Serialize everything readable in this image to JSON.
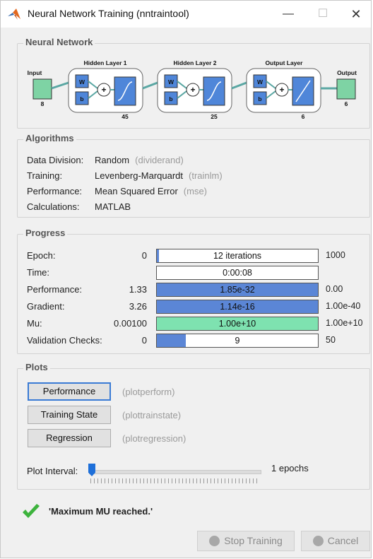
{
  "window": {
    "title": "Neural Network Training (nntraintool)",
    "controls": {
      "minimize": "—",
      "maximize": "☐",
      "close": "✕"
    }
  },
  "network": {
    "section_label": "Neural Network",
    "input": {
      "label": "Input",
      "size": "8"
    },
    "layers": [
      {
        "label": "Hidden Layer 1",
        "size": "45"
      },
      {
        "label": "Hidden Layer 2",
        "size": "25"
      },
      {
        "label": "Output Layer",
        "size": "6"
      }
    ],
    "output": {
      "label": "Output",
      "size": "6"
    },
    "weight_symbol": "W",
    "bias_symbol": "b",
    "colors": {
      "io_box": "#7ed3a4",
      "weight_box": "#4f86d9",
      "transfer_box": "#4f86d9",
      "connector": "#5aa7a3"
    }
  },
  "algorithms": {
    "section_label": "Algorithms",
    "rows": [
      {
        "label": "Data Division:",
        "value": "Random",
        "fn": "(dividerand)"
      },
      {
        "label": "Training:",
        "value": "Levenberg-Marquardt",
        "fn": "(trainlm)"
      },
      {
        "label": "Performance:",
        "value": "Mean Squared Error",
        "fn": "(mse)"
      },
      {
        "label": "Calculations:",
        "value": "MATLAB",
        "fn": ""
      }
    ]
  },
  "progress": {
    "section_label": "Progress",
    "rows": [
      {
        "label": "Epoch:",
        "start": "0",
        "text": "12 iterations",
        "end": "1000",
        "fill": 0.012,
        "color": "#5b86d6"
      },
      {
        "label": "Time:",
        "start": "",
        "text": "0:00:08",
        "end": "",
        "fill": 0,
        "color": "#5b86d6"
      },
      {
        "label": "Performance:",
        "start": "1.33",
        "text": "1.85e-32",
        "end": "0.00",
        "fill": 1,
        "color": "#5b86d6"
      },
      {
        "label": "Gradient:",
        "start": "3.26",
        "text": "1.14e-16",
        "end": "1.00e-40",
        "fill": 1,
        "color": "#5b86d6"
      },
      {
        "label": "Mu:",
        "start": "0.00100",
        "text": "1.00e+10",
        "end": "1.00e+10",
        "fill": 1,
        "color": "#7ee2b0"
      },
      {
        "label": "Validation Checks:",
        "start": "0",
        "text": "9",
        "end": "50",
        "fill": 0.18,
        "color": "#5b86d6"
      }
    ]
  },
  "plots": {
    "section_label": "Plots",
    "buttons": [
      {
        "label": "Performance",
        "fn": "(plotperform)"
      },
      {
        "label": "Training State",
        "fn": "(plottrainstate)"
      },
      {
        "label": "Regression",
        "fn": "(plotregression)"
      }
    ],
    "interval_label": "Plot Interval:",
    "interval_value": "1 epochs",
    "slider_position": 0
  },
  "status": {
    "message": "'Maximum MU reached.'"
  },
  "footer": {
    "stop_label": "Stop Training",
    "cancel_label": "Cancel"
  }
}
